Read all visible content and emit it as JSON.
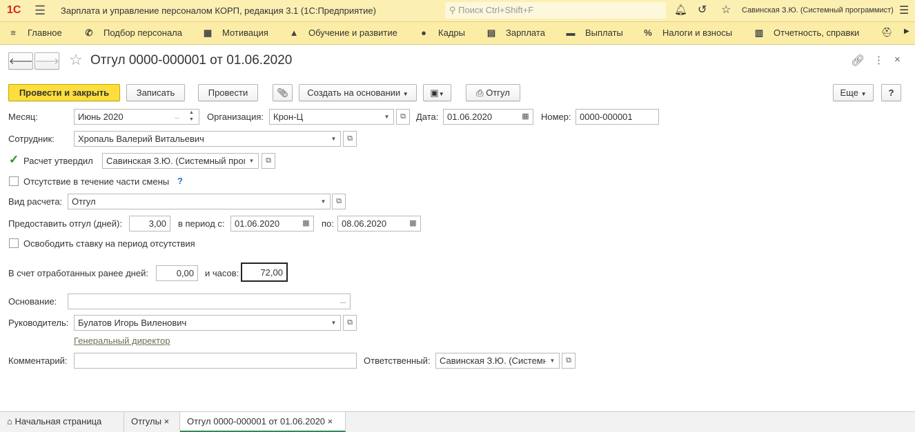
{
  "app": {
    "title": "Зарплата и управление персоналом КОРП, редакция 3.1  (1С:Предприятие)",
    "search_placeholder": "Поиск Ctrl+Shift+F",
    "user": "Савинская З.Ю. (Системный программист)"
  },
  "nav": [
    "Главное",
    "Подбор персонала",
    "Мотивация",
    "Обучение и развитие",
    "Кадры",
    "Зарплата",
    "Выплаты",
    "Налоги и взносы",
    "Отчетность, справки"
  ],
  "doc": {
    "title": "Отгул 0000-000001 от 01.06.2020"
  },
  "toolbar": {
    "post_close": "Провести и закрыть",
    "save": "Записать",
    "post": "Провести",
    "create_based": "Создать на основании",
    "print": "Отгул",
    "more": "Еще",
    "help": "?"
  },
  "form": {
    "month_label": "Месяц:",
    "month": "Июнь 2020",
    "org_label": "Организация:",
    "org": "Крон-Ц",
    "date_label": "Дата:",
    "date": "01.06.2020",
    "number_label": "Номер:",
    "number": "0000-000001",
    "employee_label": "Сотрудник:",
    "employee": "Хропаль Валерий Витальевич",
    "approved_label": "Расчет утвердил",
    "approved_by": "Савинская З.Ю. (Системный программист)",
    "partial_label": "Отсутствие в течение части смены",
    "partial_help": "?",
    "calc_type_label": "Вид расчета:",
    "calc_type": "Отгул",
    "days_label": "Предоставить отгул (дней):",
    "days": "3,00",
    "period_from_label": "в период с:",
    "period_from": "01.06.2020",
    "period_to_label": "по:",
    "period_to": "08.06.2020",
    "release_label": "Освободить ставку на период отсутствия",
    "worked_days_label": "В счет отработанных ранее дней:",
    "worked_days": "0,00",
    "hours_label": "и часов:",
    "hours": "72,00",
    "basis_label": "Основание:",
    "basis": "",
    "manager_label": "Руководитель:",
    "manager": "Булатов Игорь Виленович",
    "manager_position": "Генеральный директор",
    "comment_label": "Комментарий:",
    "comment": "",
    "responsible_label": "Ответственный:",
    "responsible": "Савинская З.Ю. (Системный программист)"
  },
  "tabs": [
    "Начальная страница",
    "Отгулы",
    "Отгул 0000-000001 от 01.06.2020"
  ]
}
